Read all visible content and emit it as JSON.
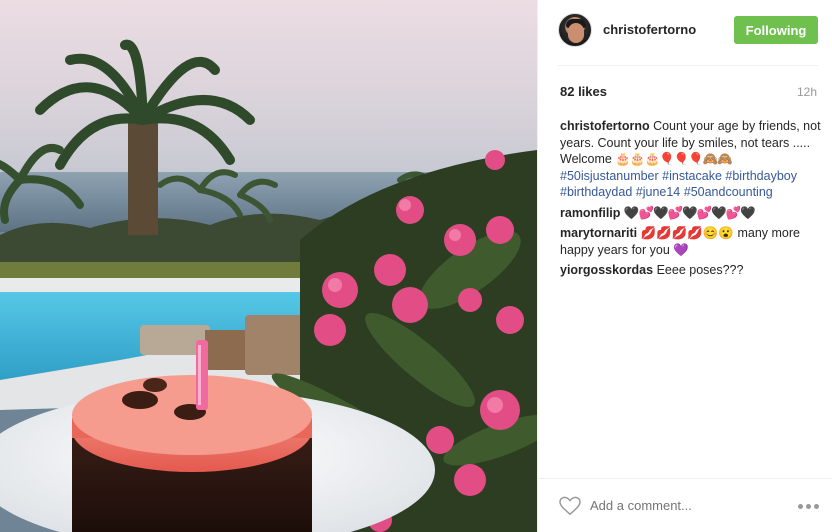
{
  "post": {
    "username": "christofertorno",
    "follow_button": "Following",
    "likes": "82 likes",
    "time_ago": "12h",
    "caption": {
      "user": "christofertorno",
      "text": "Count your age by friends, not years. Count your life by smiles, not tears .....",
      "welcome": "Welcome",
      "welcome_emoji": "🎂🎂🎂🎈🎈🎈🙈🙈",
      "hashtags": [
        "#50isjustanumber",
        "#instacake",
        "#birthdayboy",
        "#birthdaydad",
        "#june14",
        "#50andcounting"
      ]
    },
    "comments": [
      {
        "user": "ramonfilip",
        "text": "🖤💕🖤💕🖤💕🖤💕🖤"
      },
      {
        "user": "marytornariti",
        "text": "💋💋💋💋😊😮 many more happy years for you 💜"
      },
      {
        "user": "yiorgosskordas",
        "text": "Eeee poses???"
      }
    ],
    "add_comment_placeholder": "Add a comment...",
    "icons": {
      "like": "heart-icon",
      "more": "more-options-icon",
      "avatar": "profile-avatar"
    },
    "colors": {
      "follow_green": "#70c050",
      "hashtag_blue": "#365899",
      "muted": "#999999"
    }
  }
}
